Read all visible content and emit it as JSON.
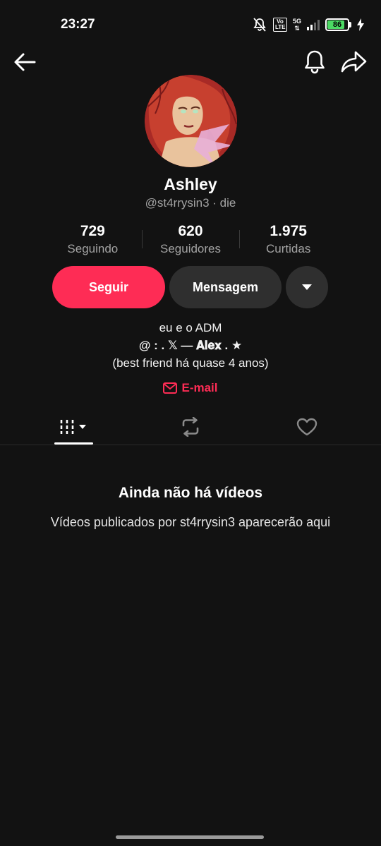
{
  "status_bar": {
    "time": "23:27",
    "volte_top": "Vo",
    "volte_bottom": "LTE",
    "network_top": "5G",
    "network_bottom": "⇅",
    "battery_level": "86",
    "battery_fraction": 0.86,
    "icons": [
      "mute-icon",
      "volte-icon",
      "5g-icon",
      "signal-icon",
      "battery-icon",
      "charging-icon"
    ]
  },
  "nav": {
    "icons": [
      "back-arrow-icon",
      "bell-icon",
      "share-icon"
    ]
  },
  "profile": {
    "display_name": "Ashley",
    "handle": "@st4rrysin3 · die",
    "stats": [
      {
        "value": "729",
        "label": "Seguindo"
      },
      {
        "value": "620",
        "label": "Seguidores"
      },
      {
        "value": "1.975",
        "label": "Curtidas"
      }
    ]
  },
  "actions": {
    "follow_label": "Seguir",
    "message_label": "Mensagem"
  },
  "bio": {
    "line1": "eu e o ADM",
    "line2": "@ :  . 𝕏 — 𝐀𝐥𝐞𝐱  . ★",
    "line3": "(best friend há quase 4 anos)"
  },
  "email_label": "E-mail",
  "tabs": [
    "videos-grid-icon",
    "repost-icon",
    "liked-heart-icon"
  ],
  "empty_state": {
    "title": "Ainda não há vídeos",
    "subtitle": "Vídeos publicados por st4rrysin3 aparecerão aqui"
  },
  "colors": {
    "accent": "#fe2c55",
    "background": "#121212",
    "button_secondary": "#2f2f2f",
    "battery": "#4cd964"
  }
}
